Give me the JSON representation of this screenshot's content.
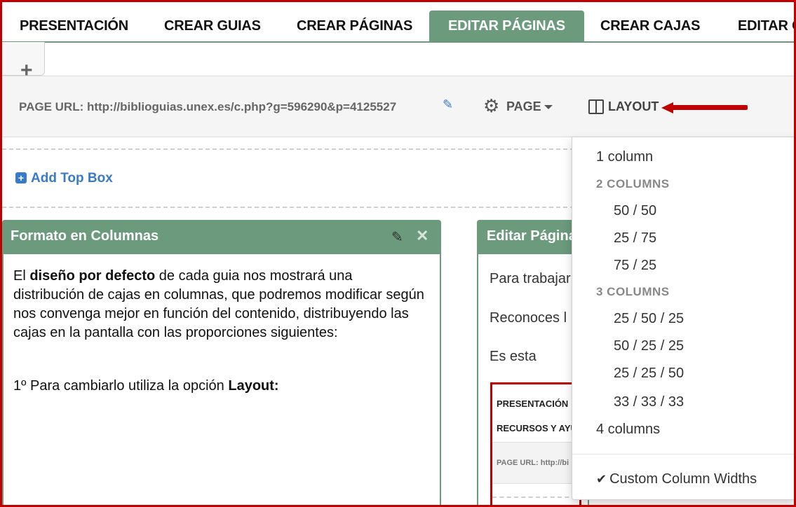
{
  "tabs": [
    {
      "label": "PRESENTACIÓN",
      "active": false
    },
    {
      "label": "CREAR GUIAS",
      "active": false
    },
    {
      "label": "CREAR PÁGINAS",
      "active": false
    },
    {
      "label": "EDITAR PÁGINAS",
      "active": true
    },
    {
      "label": "CREAR CAJAS",
      "active": false
    },
    {
      "label": "EDITAR C",
      "active": false
    }
  ],
  "add_tab_symbol": "+",
  "toolbar": {
    "page_url_label": "PAGE URL: http://biblioguias.unex.es/c.php?g=596290&p=4125527",
    "page_menu_label": "PAGE",
    "layout_label": "LAYOUT"
  },
  "add_top_box_label": "Add Top Box",
  "left_box": {
    "title": "Formato en Columnas",
    "para1_prefix": "El ",
    "para1_bold": "diseño por defecto",
    "para1_rest": "  de cada guia nos mostrará una distribución de cajas en columnas, que podremos modificar según nos convenga mejor en función del contenido, distribuyendo las cajas en la pantalla con las proporciones siguientes:",
    "para2_prefix": "1º Para cambiarlo utiliza la opción ",
    "para2_bold": "Layout:"
  },
  "right_box": {
    "title": "Editar Página",
    "line1": "Para trabajar",
    "line2": "Reconoces l",
    "line3": "Es esta",
    "inner": {
      "tab1": "PRESENTACIÓN",
      "tab2": "RECURSOS Y AYU",
      "url": "PAGE URL: http://bi"
    }
  },
  "layout_menu": {
    "one_column": "1 column",
    "two_columns_header": "2 COLUMNS",
    "two_columns_options": [
      "50 / 50",
      "25 / 75",
      "75 / 25"
    ],
    "three_columns_header": "3 COLUMNS",
    "three_columns_options": [
      "25 / 50 / 25",
      "50 / 25 / 25",
      "25 / 25 / 50",
      "33 / 33 / 33"
    ],
    "four_columns": "4 columns",
    "custom_widths": "Custom Column Widths"
  },
  "colors": {
    "accent_green": "#6b9a7d",
    "link_blue": "#3a7bc8",
    "annotation_red": "#c00000"
  }
}
